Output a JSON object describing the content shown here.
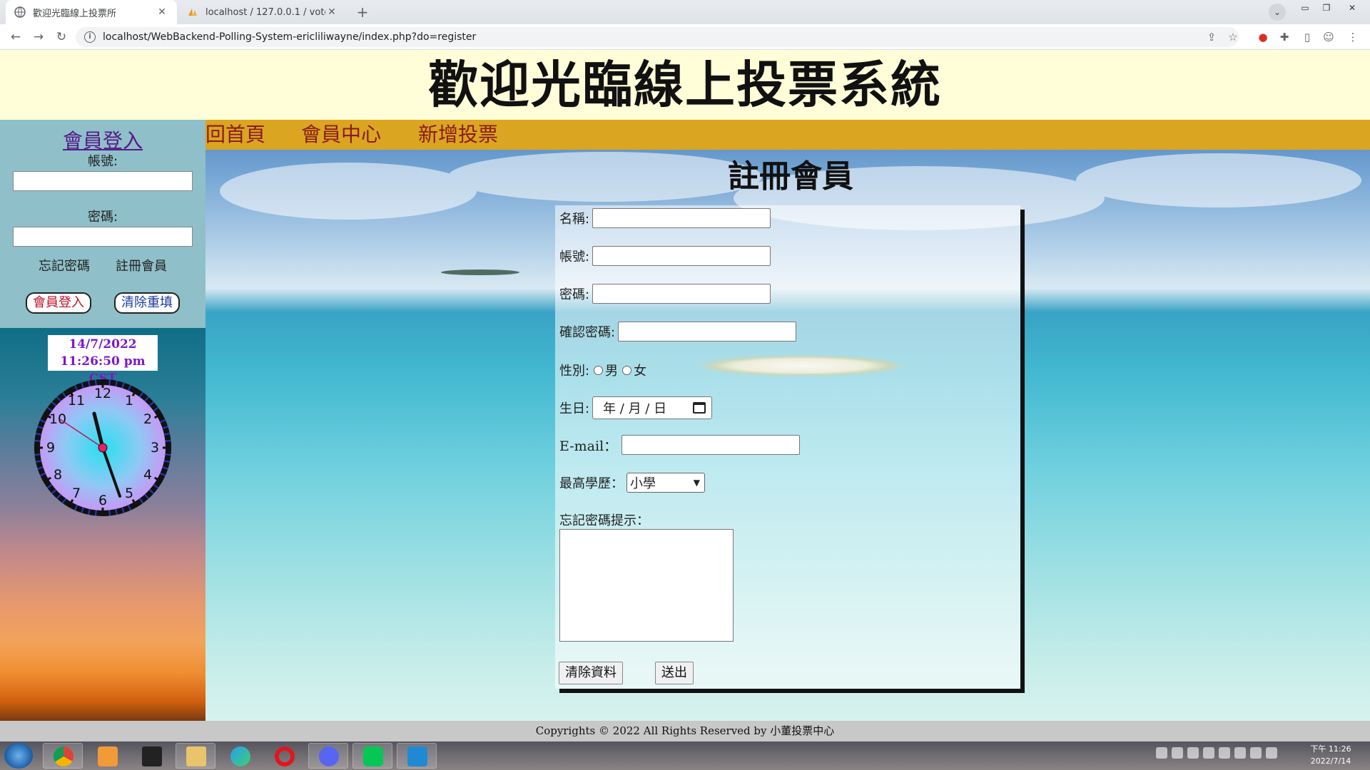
{
  "browser": {
    "tabs": [
      {
        "title": "歡迎光臨線上投票所",
        "active": true
      },
      {
        "title": "localhost / 127.0.0.1 / votesyste",
        "active": false
      }
    ],
    "url": "localhost/WebBackend-Polling-System-ericliliwayne/index.php?do=register"
  },
  "site": {
    "title": "歡迎光臨線上投票系統"
  },
  "sidebar": {
    "login_title": "會員登入",
    "account_label": "帳號:",
    "password_label": "密碼:",
    "forgot_link": "忘記密碼",
    "register_link": "註冊會員",
    "login_button": "會員登入",
    "reset_button": "清除重填",
    "date": "14/7/2022",
    "time": "11:26:50 pm CST"
  },
  "nav": {
    "home": "回首頁",
    "member_center": "會員中心",
    "new_poll": "新增投票"
  },
  "form": {
    "title": "註冊會員",
    "name_label": "名稱:",
    "account_label": "帳號:",
    "password_label": "密碼:",
    "confirm_label": "確認密碼:",
    "gender_label": "性別:",
    "gender_male": "男",
    "gender_female": "女",
    "birthday_label": "生日:",
    "birthday_placeholder": "年 / 月 / 日",
    "email_label": "E-mail：",
    "education_label": "最高學歷：",
    "education_selected": "小學",
    "hint_label": "忘記密碼提示：",
    "clear_button": "清除資料",
    "submit_button": "送出"
  },
  "footer": {
    "text": "Copyrights © 2022 All Rights Reserved by 小董投票中心"
  },
  "taskbar": {
    "time": "下午 11:26",
    "date": "2022/7/14"
  },
  "colors": {
    "header_bg": "#fffed8",
    "nav_bg": "#daa520",
    "nav_text": "#8b1a1a",
    "login_panel_bg": "#8fbfc9",
    "date_text": "#7b17c9"
  }
}
